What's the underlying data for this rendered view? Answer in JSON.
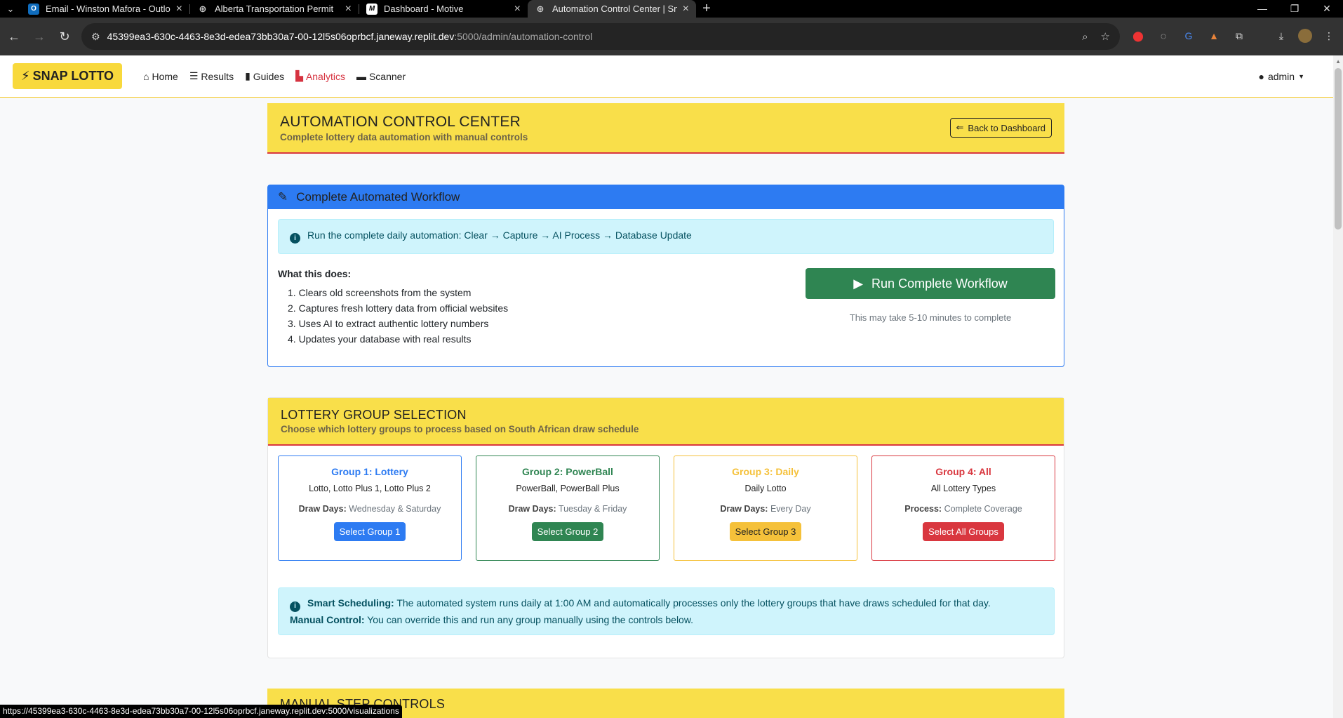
{
  "browser": {
    "tabs": [
      {
        "title": "Email - Winston Mafora - Outlo",
        "icon": "outlook-icon"
      },
      {
        "title": "Alberta Transportation Permit",
        "icon": "globe-icon"
      },
      {
        "title": "Dashboard - Motive",
        "icon": "motive-icon"
      },
      {
        "title": "Automation Control Center | Sn",
        "icon": "globe-icon"
      }
    ],
    "url_host": "45399ea3-630c-4463-8e3d-edea73bb30a7-00-12l5s06oprbcf.janeway.replit.dev",
    "url_path": ":5000/admin/automation-control",
    "status_url": "https://45399ea3-630c-4463-8e3d-edea73bb30a7-00-12l5s06oprbcf.janeway.replit.dev:5000/visualizations"
  },
  "app": {
    "brand": "SNAP LOTTO",
    "nav": [
      {
        "label": "Home",
        "icon": "home-icon"
      },
      {
        "label": "Results",
        "icon": "list-icon"
      },
      {
        "label": "Guides",
        "icon": "book-icon"
      },
      {
        "label": "Analytics",
        "icon": "chart-icon"
      },
      {
        "label": "Scanner",
        "icon": "scanner-icon"
      }
    ],
    "user": "admin"
  },
  "header": {
    "title": "AUTOMATION CONTROL CENTER",
    "subtitle": "Complete lottery data automation with manual controls",
    "back_label": "Back to Dashboard"
  },
  "workflow": {
    "title": "Complete Automated Workflow",
    "info": "Run the complete daily automation: Clear → Capture → AI Process → Database Update",
    "what_label": "What this does:",
    "steps": [
      "1. Clears old screenshots from the system",
      "2. Captures fresh lottery data from official websites",
      "3. Uses AI to extract authentic lottery numbers",
      "4. Updates your database with real results"
    ],
    "run_label": "Run Complete Workflow",
    "note": "This may take 5-10 minutes to complete"
  },
  "groups": {
    "title": "LOTTERY GROUP SELECTION",
    "subtitle": "Choose which lottery groups to process based on South African draw schedule",
    "items": [
      {
        "title": "Group 1: Lottery",
        "games": "Lotto, Lotto Plus 1, Lotto Plus 2",
        "key": "Draw Days:",
        "value": "Wednesday & Saturday",
        "button": "Select Group 1",
        "color": "#2d7bf2"
      },
      {
        "title": "Group 2: PowerBall",
        "games": "PowerBall, PowerBall Plus",
        "key": "Draw Days:",
        "value": "Tuesday & Friday",
        "button": "Select Group 2",
        "color": "#2f8552"
      },
      {
        "title": "Group 3: Daily",
        "games": "Daily Lotto",
        "key": "Draw Days:",
        "value": "Every Day",
        "button": "Select Group 3",
        "color": "#f5c13a"
      },
      {
        "title": "Group 4: All",
        "games": "All Lottery Types",
        "key": "Process:",
        "value": "Complete Coverage",
        "button": "Select All Groups",
        "color": "#d9373f"
      }
    ],
    "smart_label": "Smart Scheduling:",
    "smart_text": "The automated system runs daily at 1:00 AM and automatically processes only the lottery groups that have draws scheduled for that day.",
    "manual_label": "Manual Control:",
    "manual_text": "You can override this and run any group manually using the controls below."
  },
  "manual": {
    "title": "MANUAL STEP CONTROLS"
  }
}
